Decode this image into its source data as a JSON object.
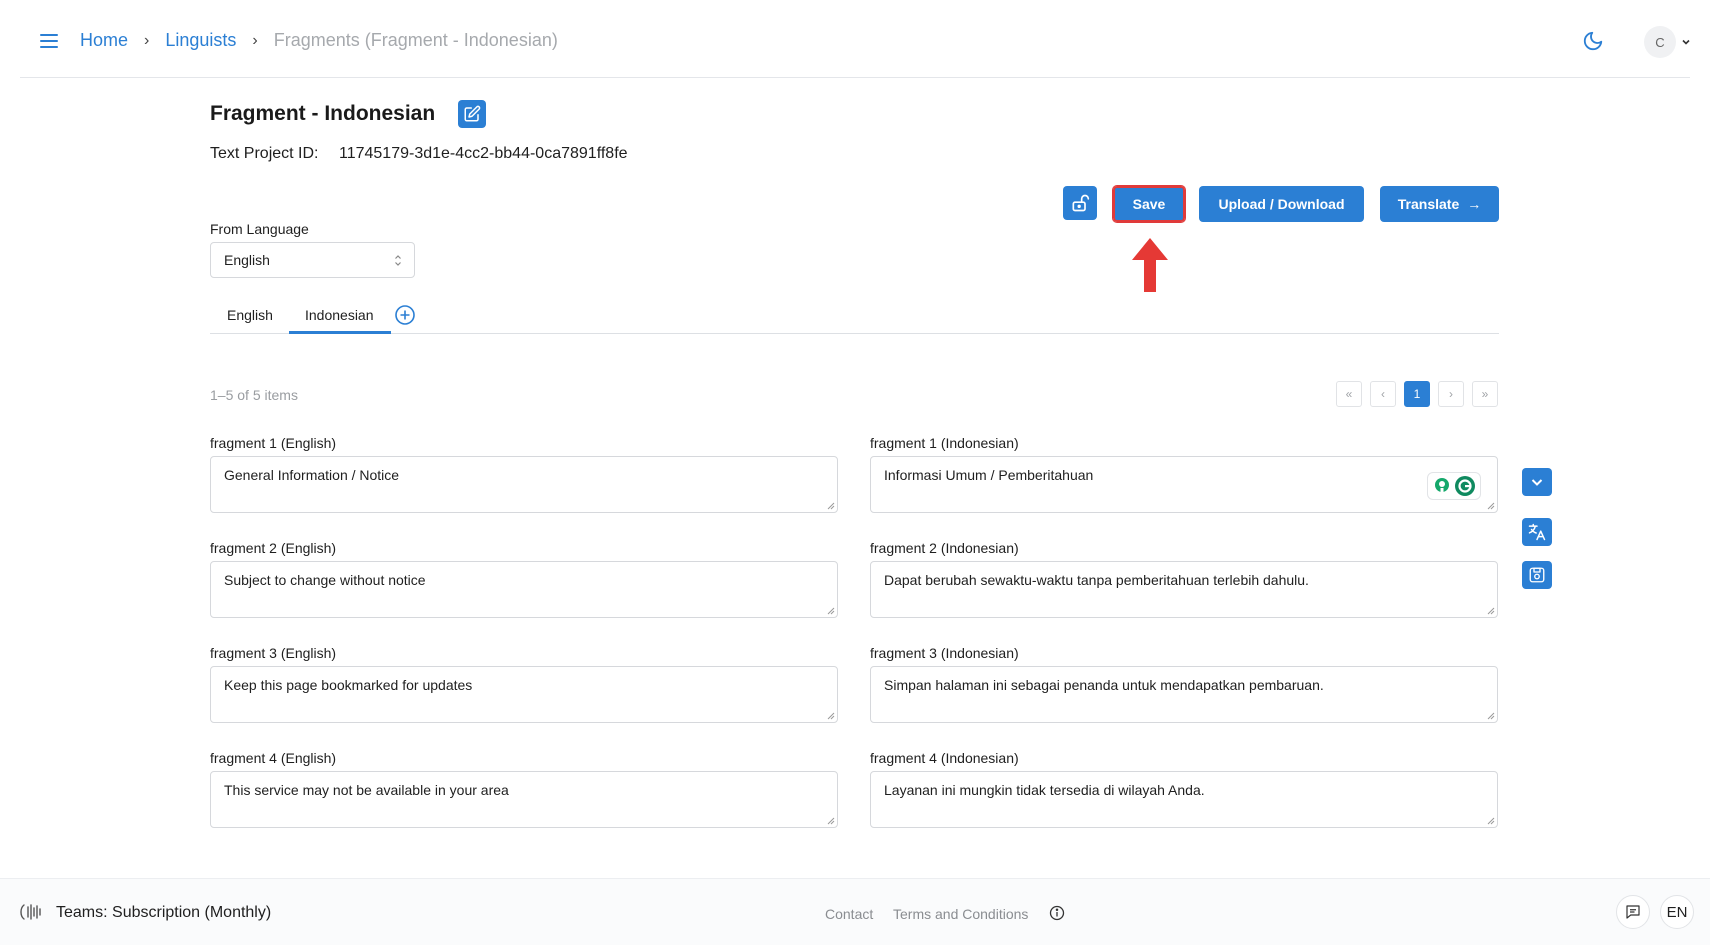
{
  "breadcrumb": {
    "home": "Home",
    "linguists": "Linguists",
    "current": "Fragments (Fragment - Indonesian)"
  },
  "user": {
    "avatar_initial": "C"
  },
  "page": {
    "title": "Fragment - Indonesian",
    "project_id_label": "Text Project ID:",
    "project_id_value": "11745179-3d1e-4cc2-bb44-0ca7891ff8fe"
  },
  "actions": {
    "save_label": "Save",
    "upload_label": "Upload / Download",
    "translate_label": "Translate",
    "translate_arrow": "→"
  },
  "from_language": {
    "label": "From Language",
    "selected": "English"
  },
  "tabs": [
    {
      "label": "English"
    },
    {
      "label": "Indonesian",
      "active": true
    }
  ],
  "pagination": {
    "summary": "1–5 of 5 items",
    "first": "«",
    "prev": "‹",
    "current_page": "1",
    "next": "›",
    "last": "»"
  },
  "fragments": [
    {
      "source_label": "fragment 1 (English)",
      "source_text": "General Information / Notice",
      "target_label": "fragment 1 (Indonesian)",
      "target_text": "Informasi Umum / Pemberitahuan"
    },
    {
      "source_label": "fragment 2 (English)",
      "source_text": "Subject to change without notice",
      "target_label": "fragment 2 (Indonesian)",
      "target_text": "Dapat berubah sewaktu-waktu tanpa pemberitahuan terlebih dahulu."
    },
    {
      "source_label": "fragment 3 (English)",
      "source_text": "Keep this page bookmarked for updates",
      "target_label": "fragment 3 (Indonesian)",
      "target_text": "Simpan halaman ini sebagai penanda untuk mendapatkan pembaruan."
    },
    {
      "source_label": "fragment 4 (English)",
      "source_text": "This service may not be available in your area",
      "target_label": "fragment 4 (Indonesian)",
      "target_text": "Layanan ini mungkin tidak tersedia di wilayah Anda."
    }
  ],
  "footer": {
    "plan": "Teams: Subscription (Monthly)",
    "contact": "Contact",
    "terms": "Terms and Conditions",
    "language": "EN"
  },
  "colors": {
    "accent": "#2b7fd4",
    "highlight": "#e03a3a"
  }
}
